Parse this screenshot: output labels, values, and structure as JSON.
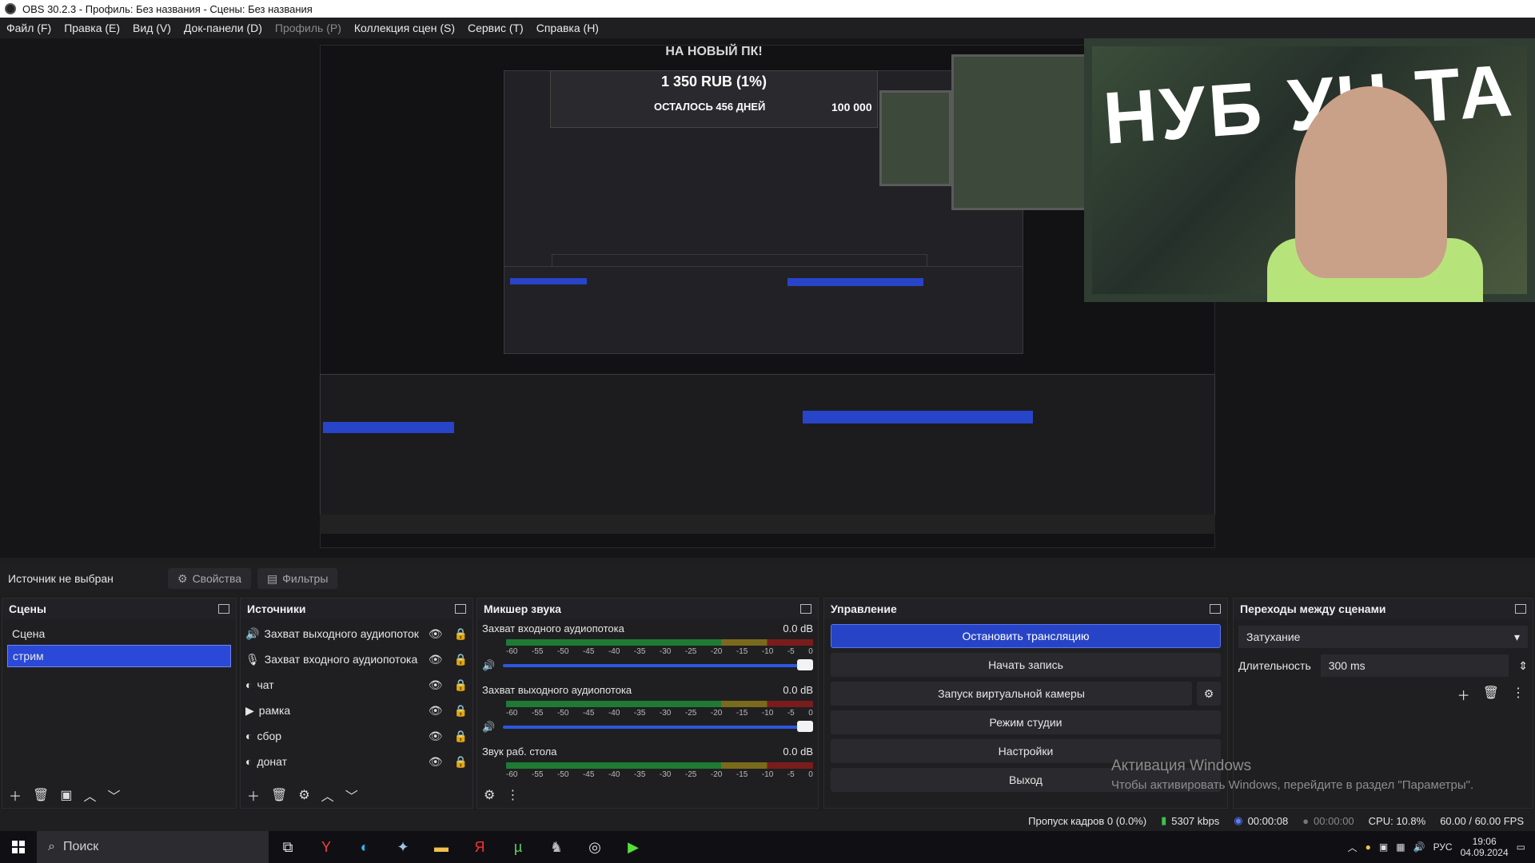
{
  "titlebar": {
    "title": "OBS 30.2.3 - Профиль: Без названия - Сцены: Без названия"
  },
  "menu": [
    "Файл (F)",
    "Правка (E)",
    "Вид (V)",
    "Док-панели (D)",
    "Профиль (P)",
    "Коллекция сцен (S)",
    "Сервис (T)",
    "Справка (H)"
  ],
  "preview": {
    "donation_title": "НА НОВЫЙ ПК!",
    "donation_amount": "1 350 RUB (1%)",
    "donation_days": "ОСТАЛОСЬ 456 ДНЕЙ",
    "donation_goal": "100 000",
    "cam_logo": "НУБ УЧ ТА"
  },
  "context": {
    "label": "Источник не выбран",
    "properties": "Свойства",
    "filters": "Фильтры"
  },
  "scenes": {
    "title": "Сцены",
    "items": [
      "Сцена",
      "стрим"
    ],
    "selected_index": 1
  },
  "sources": {
    "title": "Источники",
    "items": [
      {
        "name": "Захват выходного аудиопоток",
        "icon": "speaker-icon"
      },
      {
        "name": "Захват входного аудиопотока",
        "icon": "mic-icon"
      },
      {
        "name": "чат",
        "icon": "globe-icon"
      },
      {
        "name": "рамка",
        "icon": "play-icon"
      },
      {
        "name": "сбор",
        "icon": "globe-icon"
      },
      {
        "name": "донат",
        "icon": "globe-icon"
      }
    ]
  },
  "mixer": {
    "title": "Микшер звука",
    "channels": [
      {
        "name": "Захват входного аудиопотока",
        "db": "0.0 dB"
      },
      {
        "name": "Захват выходного аудиопотока",
        "db": "0.0 dB"
      },
      {
        "name": "Звук раб. стола",
        "db": "0.0 dB"
      }
    ],
    "ticks": [
      "-60",
      "-55",
      "-50",
      "-45",
      "-40",
      "-35",
      "-30",
      "-25",
      "-20",
      "-15",
      "-10",
      "-5",
      "0"
    ],
    "volume_level": 1.0
  },
  "controls": {
    "title": "Управление",
    "stop_stream": "Остановить трансляцию",
    "start_recording": "Начать запись",
    "virtual_camera": "Запуск виртуальной камеры",
    "studio_mode": "Режим студии",
    "settings": "Настройки",
    "exit": "Выход"
  },
  "transitions": {
    "title": "Переходы между сценами",
    "selected": "Затухание",
    "duration_label": "Длительность",
    "duration_value": "300 ms"
  },
  "watermark": {
    "line1": "Активация Windows",
    "line2": "Чтобы активировать Windows, перейдите в раздел \"Параметры\"."
  },
  "status": {
    "dropped_frames": "Пропуск кадров 0 (0.0%)",
    "bitrate": "5307 kbps",
    "stream_time": "00:00:08",
    "record_time": "00:00:00",
    "cpu": "CPU: 10.8%",
    "fps": "60.00 / 60.00 FPS"
  },
  "taskbar": {
    "search_placeholder": "Поиск",
    "lang": "РУС",
    "time": "19:06",
    "date": "04.09.2024"
  },
  "colors": {
    "accent": "#2744c7",
    "panel": "#1f1f22",
    "selection": "#2a49d8"
  }
}
